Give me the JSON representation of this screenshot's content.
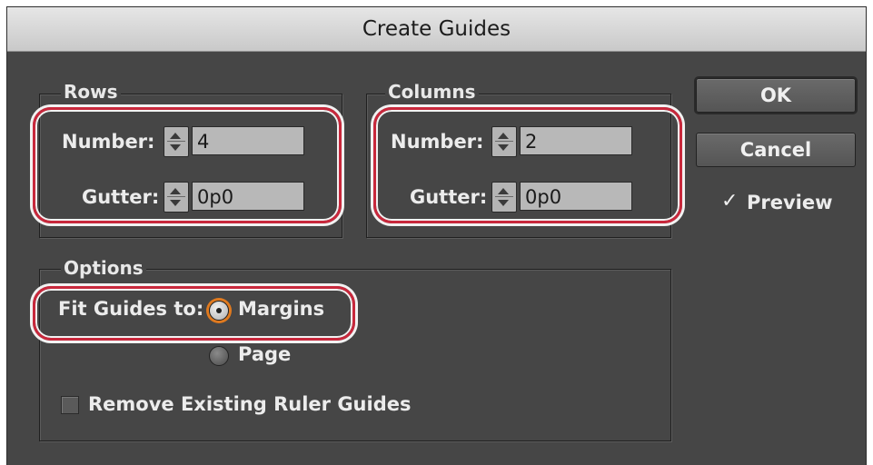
{
  "dialog": {
    "title": "Create Guides"
  },
  "rows": {
    "label": "Rows",
    "number_label": "Number:",
    "number_value": "4",
    "gutter_label": "Gutter:",
    "gutter_value": "0p0"
  },
  "columns": {
    "label": "Columns",
    "number_label": "Number:",
    "number_value": "2",
    "gutter_label": "Gutter:",
    "gutter_value": "0p0"
  },
  "options": {
    "label": "Options",
    "fit_label": "Fit Guides to:",
    "radio_margins": "Margins",
    "radio_page": "Page",
    "selected": "Margins",
    "remove_label": "Remove Existing Ruler Guides",
    "remove_checked": false
  },
  "buttons": {
    "ok": "OK",
    "cancel": "Cancel"
  },
  "preview": {
    "label": "Preview",
    "checked": true
  },
  "colors": {
    "highlight": "#c8283c",
    "dialog_bg": "#464646",
    "radio_focus": "#e07a1f"
  }
}
